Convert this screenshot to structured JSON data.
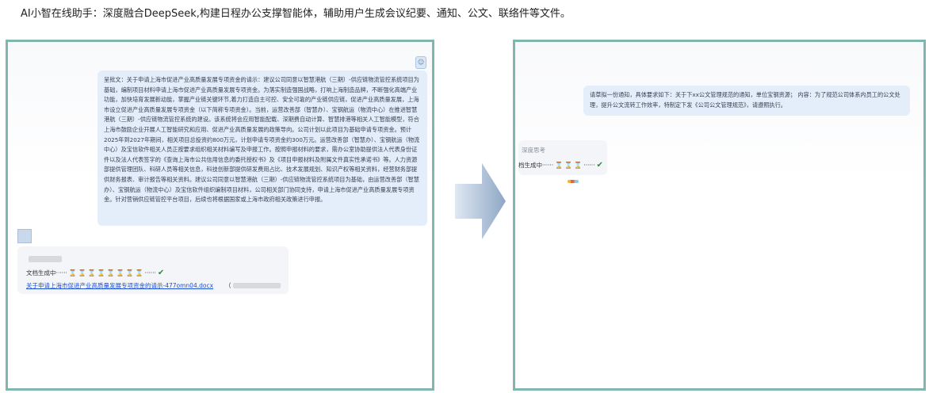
{
  "caption": "AI小智在线助手：深度融合DeepSeek,构建日程办公支撑智能体，辅助用户生成会议纪要、通知、公文、联络件等文件。",
  "left": {
    "user_message": "呈批文：关于申请上海市促进产业高质量发展专项资金的请示：建议公司同意以智慧港航（三期）-供应链物流管控系统项目为基础，编制项目材料申请上海市促进产业高质量发展专项资金。为落实制造强国战略，打响上海制造品牌，不断强化高端产业功能，加快培育发展新动能，掌握产业链关键环节,着力打造自主可控、安全可靠的产业链供应链，促进产业高质量发展，上海市设立促进产业高质量发展专项资金（以下简称专项资金）。当前，运营改善部（智慧办）、宝钢航运（物流中心）在推进智慧港航（三期）-供应链物流管控系统的建设。该系统将会应用智能配载、深期费自动计算、智慧排港等相关人工智能模型，符合上海市鼓励企业开展人工智能研究和应用、促进产业高质量发展的政策导向。公司计划以此项目为基础申请专项资金。预计2025年到2027年期间，相关项目总投资约800万元，计划申请专项资金约300万元。运营改善部（智慧办）、宝钢航运（物流中心）及宝信软件相关人员正按要求组织相关材料编写及申报工作。按照申报材料的要求，需办公室协助提供法人代表身份证件以及法人代表签字的《查询上海市公共信用信息的委托授权书》及《项目申报材料及附属文件真实性承诺书》等。人力资源部提供管理团队、科研人员等相关信息，科技创新部提供研发费用占比、技术发展规划、知识产权等相关资料，经营财务部提供财务报表、审计报告等相关资料。建议公司同意以智慧港航（三期）-供应链物流管控系统项目为基础，由运营改善部（智慧办）、宝钢航运（物流中心）及宝信软件组织编制项目材料，公司相关部门协同支持，申请上海市促进产业高质量发展专项资金。针对营销供应链管控平台项目，后续也将根据国家或上海市政府相关政策进行申报。",
    "status_label": "文档生成中······",
    "doc_link": "关于申请上海市促进产业高质量发展专项资金的请示-477omn04.docx",
    "doc_paren": "（"
  },
  "right": {
    "user_message": "请草拟一份通知，具体要求如下：关于下xx公文管理规范的通知，单位宝钢资源；  内容：为了规范公司体系内员工的公文处理，提升公文流转工作效率，特制定下发《公司公文管理规范》，请遵照执行。",
    "think_label": "深度思考",
    "status_label": "档生成中······",
    "status_tail": "······"
  },
  "colors": {
    "panel_border": "#7fb7b0",
    "user_bubble": "#e4eefb",
    "link": "#1a4fd6",
    "check": "#2e8b3d"
  },
  "icons": {
    "hourglass": "⌛",
    "check": "✔",
    "user": "☺"
  }
}
